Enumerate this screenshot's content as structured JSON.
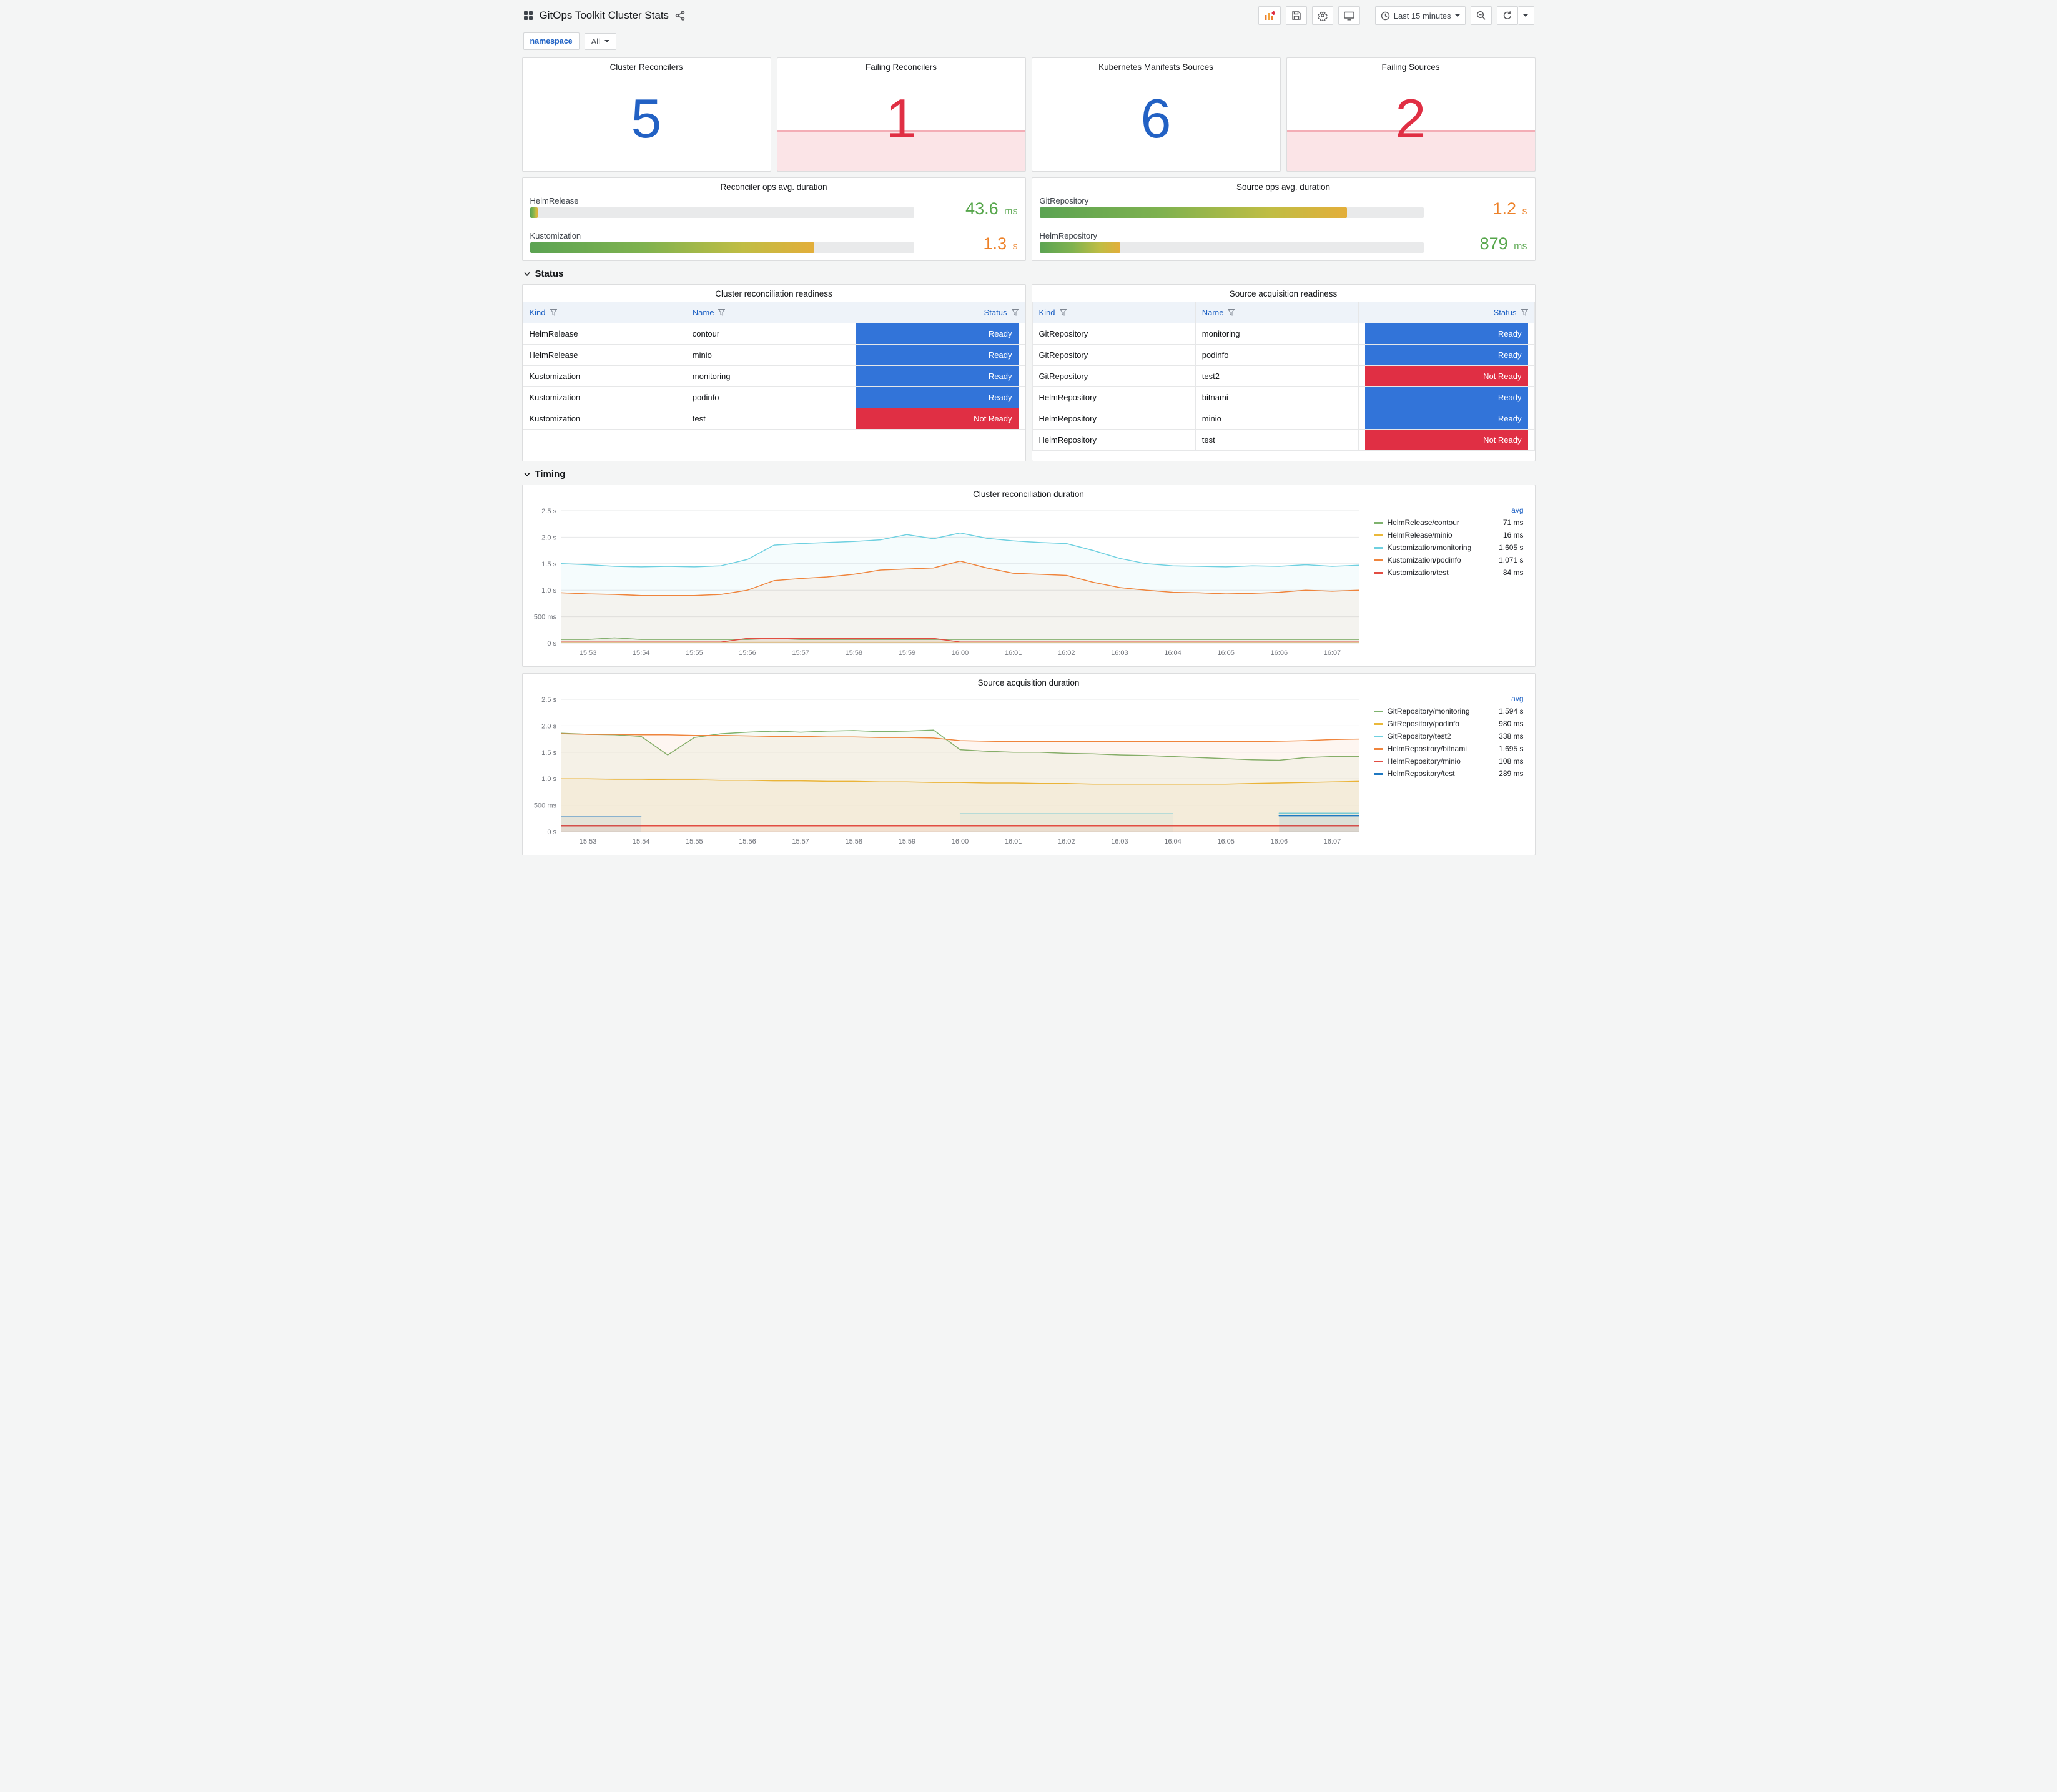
{
  "header": {
    "title": "GitOps Toolkit Cluster Stats",
    "time_range": "Last 15 minutes"
  },
  "variables": {
    "namespace": {
      "label": "namespace",
      "value": "All"
    }
  },
  "sections": {
    "status": "Status",
    "timing": "Timing"
  },
  "stat_panels": [
    {
      "title": "Cluster Reconcilers",
      "value": "5",
      "state": "ok"
    },
    {
      "title": "Failing Reconcilers",
      "value": "1",
      "state": "alerting"
    },
    {
      "title": "Kubernetes Manifests Sources",
      "value": "6",
      "state": "ok"
    },
    {
      "title": "Failing Sources",
      "value": "2",
      "state": "alerting"
    }
  ],
  "stat_colors": {
    "ok": "#2261C4",
    "alerting": "#E02F44"
  },
  "gauge_panels": [
    {
      "title": "Reconciler ops avg. duration",
      "bars": [
        {
          "label": "HelmRelease",
          "value": "43.6",
          "unit": "ms",
          "percent": 2,
          "value_color": "#56A64B"
        },
        {
          "label": "Kustomization",
          "value": "1.3",
          "unit": "s",
          "percent": 74,
          "value_color": "#ED8128"
        }
      ]
    },
    {
      "title": "Source ops avg. duration",
      "bars": [
        {
          "label": "GitRepository",
          "value": "1.2",
          "unit": "s",
          "percent": 80,
          "value_color": "#ED8128"
        },
        {
          "label": "HelmRepository",
          "value": "879",
          "unit": "ms",
          "percent": 21,
          "value_color": "#56A64B"
        }
      ]
    }
  ],
  "tables": [
    {
      "title": "Cluster reconciliation readiness",
      "columns": [
        "Kind",
        "Name",
        "Status"
      ],
      "rows": [
        [
          "HelmRelease",
          "contour",
          "Ready"
        ],
        [
          "HelmRelease",
          "minio",
          "Ready"
        ],
        [
          "Kustomization",
          "monitoring",
          "Ready"
        ],
        [
          "Kustomization",
          "podinfo",
          "Ready"
        ],
        [
          "Kustomization",
          "test",
          "Not Ready"
        ]
      ]
    },
    {
      "title": "Source acquisition readiness",
      "columns": [
        "Kind",
        "Name",
        "Status"
      ],
      "rows": [
        [
          "GitRepository",
          "monitoring",
          "Ready"
        ],
        [
          "GitRepository",
          "podinfo",
          "Ready"
        ],
        [
          "GitRepository",
          "test2",
          "Not Ready"
        ],
        [
          "HelmRepository",
          "bitnami",
          "Ready"
        ],
        [
          "HelmRepository",
          "minio",
          "Ready"
        ],
        [
          "HelmRepository",
          "test",
          "Not Ready"
        ]
      ]
    }
  ],
  "status_colors": {
    "Ready": "#3274D9",
    "Not Ready": "#E02F44"
  },
  "chart_data": [
    {
      "type": "line",
      "title": "Cluster reconciliation duration",
      "ylim": [
        0,
        2.5
      ],
      "grid": true,
      "legend_position": "right",
      "legend_header": "avg",
      "y_ticks": [
        {
          "v": 0,
          "label": "0 s"
        },
        {
          "v": 0.5,
          "label": "500 ms"
        },
        {
          "v": 1,
          "label": "1.0 s"
        },
        {
          "v": 1.5,
          "label": "1.5 s"
        },
        {
          "v": 2,
          "label": "2.0 s"
        },
        {
          "v": 2.5,
          "label": "2.5 s"
        }
      ],
      "x_tick_labels": [
        "15:53",
        "15:54",
        "15:55",
        "15:56",
        "15:57",
        "15:58",
        "15:59",
        "16:00",
        "16:01",
        "16:02",
        "16:03",
        "16:04",
        "16:05",
        "16:06",
        "16:07"
      ],
      "x_tick_start": 1,
      "x_tick_step": 2,
      "series": [
        {
          "name": "HelmRelease/contour",
          "avg": "71 ms",
          "color": "#7EB26D",
          "values": [
            0.07,
            0.07,
            0.1,
            0.07,
            0.07,
            0.07,
            0.07,
            0.07,
            0.09,
            0.07,
            0.07,
            0.07,
            0.07,
            0.07,
            0.07,
            0.07,
            0.07,
            0.07,
            0.07,
            0.07,
            0.07,
            0.07,
            0.07,
            0.07,
            0.07,
            0.07,
            0.07,
            0.07,
            0.07,
            0.07,
            0.07
          ]
        },
        {
          "name": "HelmRelease/minio",
          "avg": "16 ms",
          "color": "#EAB839",
          "values": [
            0.016,
            0.016,
            0.016,
            0.016,
            0.016,
            0.016,
            0.016,
            0.016,
            0.016,
            0.016,
            0.016,
            0.016,
            0.016,
            0.016,
            0.016,
            0.016,
            0.016,
            0.016,
            0.016,
            0.016,
            0.016,
            0.016,
            0.016,
            0.016,
            0.016,
            0.016,
            0.016,
            0.016,
            0.016,
            0.016,
            0.016
          ]
        },
        {
          "name": "Kustomization/monitoring",
          "avg": "1.605 s",
          "color": "#6ED0E0",
          "values": [
            1.5,
            1.48,
            1.45,
            1.44,
            1.45,
            1.44,
            1.46,
            1.58,
            1.85,
            1.88,
            1.9,
            1.92,
            1.95,
            2.05,
            1.97,
            2.08,
            1.98,
            1.93,
            1.9,
            1.88,
            1.75,
            1.6,
            1.5,
            1.46,
            1.45,
            1.44,
            1.46,
            1.45,
            1.48,
            1.45,
            1.47
          ]
        },
        {
          "name": "Kustomization/podinfo",
          "avg": "1.071 s",
          "color": "#EF843C",
          "values": [
            0.95,
            0.93,
            0.92,
            0.9,
            0.9,
            0.9,
            0.92,
            1.0,
            1.18,
            1.22,
            1.25,
            1.3,
            1.38,
            1.4,
            1.42,
            1.55,
            1.42,
            1.32,
            1.3,
            1.28,
            1.15,
            1.05,
            1.0,
            0.96,
            0.95,
            0.93,
            0.94,
            0.96,
            1.0,
            0.98,
            1.0
          ]
        },
        {
          "name": "Kustomization/test",
          "avg": "84 ms",
          "color": "#E24D42",
          "values": [
            0.02,
            0.02,
            0.02,
            0.02,
            0.02,
            0.02,
            0.02,
            0.09,
            0.09,
            0.09,
            0.09,
            0.09,
            0.09,
            0.09,
            0.09,
            0.02,
            0.02,
            0.02,
            0.02,
            0.02,
            0.02,
            0.02,
            0.02,
            0.02,
            0.02,
            0.02,
            0.02,
            0.02,
            0.02,
            0.02,
            0.02
          ]
        }
      ]
    },
    {
      "type": "line",
      "title": "Source acquisition duration",
      "ylim": [
        0,
        2.5
      ],
      "grid": true,
      "legend_position": "right",
      "legend_header": "avg",
      "y_ticks": [
        {
          "v": 0,
          "label": "0 s"
        },
        {
          "v": 0.5,
          "label": "500 ms"
        },
        {
          "v": 1,
          "label": "1.0 s"
        },
        {
          "v": 1.5,
          "label": "1.5 s"
        },
        {
          "v": 2,
          "label": "2.0 s"
        },
        {
          "v": 2.5,
          "label": "2.5 s"
        }
      ],
      "x_tick_labels": [
        "15:53",
        "15:54",
        "15:55",
        "15:56",
        "15:57",
        "15:58",
        "15:59",
        "16:00",
        "16:01",
        "16:02",
        "16:03",
        "16:04",
        "16:05",
        "16:06",
        "16:07"
      ],
      "x_tick_start": 1,
      "x_tick_step": 2,
      "series": [
        {
          "name": "GitRepository/monitoring",
          "avg": "1.594 s",
          "color": "#7EB26D",
          "values": [
            1.86,
            1.84,
            1.83,
            1.8,
            1.45,
            1.78,
            1.85,
            1.88,
            1.9,
            1.88,
            1.9,
            1.91,
            1.89,
            1.9,
            1.92,
            1.55,
            1.52,
            1.5,
            1.5,
            1.48,
            1.47,
            1.45,
            1.44,
            1.42,
            1.4,
            1.38,
            1.36,
            1.35,
            1.4,
            1.42,
            1.42
          ]
        },
        {
          "name": "GitRepository/podinfo",
          "avg": "980 ms",
          "color": "#EAB839",
          "values": [
            1.0,
            1.0,
            0.99,
            0.99,
            0.98,
            0.98,
            0.97,
            0.97,
            0.96,
            0.96,
            0.95,
            0.95,
            0.94,
            0.94,
            0.93,
            0.93,
            0.92,
            0.92,
            0.91,
            0.91,
            0.9,
            0.9,
            0.9,
            0.9,
            0.9,
            0.9,
            0.91,
            0.92,
            0.93,
            0.94,
            0.95
          ]
        },
        {
          "name": "GitRepository/test2",
          "avg": "338 ms",
          "color": "#6ED0E0",
          "values": [
            null,
            null,
            null,
            null,
            null,
            null,
            null,
            null,
            null,
            null,
            null,
            null,
            null,
            null,
            null,
            0.34,
            0.34,
            0.34,
            0.34,
            0.34,
            0.34,
            0.34,
            0.34,
            0.34,
            null,
            null,
            null,
            0.35,
            0.35,
            0.35,
            0.35
          ]
        },
        {
          "name": "HelmRepository/bitnami",
          "avg": "1.695 s",
          "color": "#EF843C",
          "values": [
            1.85,
            1.84,
            1.84,
            1.83,
            1.83,
            1.82,
            1.82,
            1.81,
            1.8,
            1.8,
            1.79,
            1.79,
            1.78,
            1.78,
            1.77,
            1.72,
            1.71,
            1.7,
            1.7,
            1.7,
            1.7,
            1.7,
            1.7,
            1.7,
            1.7,
            1.7,
            1.7,
            1.71,
            1.72,
            1.74,
            1.75
          ]
        },
        {
          "name": "HelmRepository/minio",
          "avg": "108 ms",
          "color": "#E24D42",
          "values": [
            0.108,
            0.108,
            0.108,
            0.108,
            0.108,
            0.108,
            0.108,
            0.108,
            0.108,
            0.108,
            0.108,
            0.108,
            0.108,
            0.108,
            0.108,
            0.108,
            0.108,
            0.108,
            0.108,
            0.108,
            0.108,
            0.108,
            0.108,
            0.108,
            0.108,
            0.108,
            0.108,
            0.108,
            0.108,
            0.108,
            0.108
          ]
        },
        {
          "name": "HelmRepository/test",
          "avg": "289 ms",
          "color": "#1F78C1",
          "values": [
            0.28,
            0.28,
            0.28,
            0.28,
            null,
            null,
            null,
            null,
            null,
            null,
            null,
            null,
            null,
            null,
            null,
            null,
            null,
            null,
            null,
            null,
            null,
            null,
            null,
            null,
            null,
            null,
            null,
            0.3,
            0.3,
            0.3,
            0.3
          ]
        }
      ]
    }
  ]
}
